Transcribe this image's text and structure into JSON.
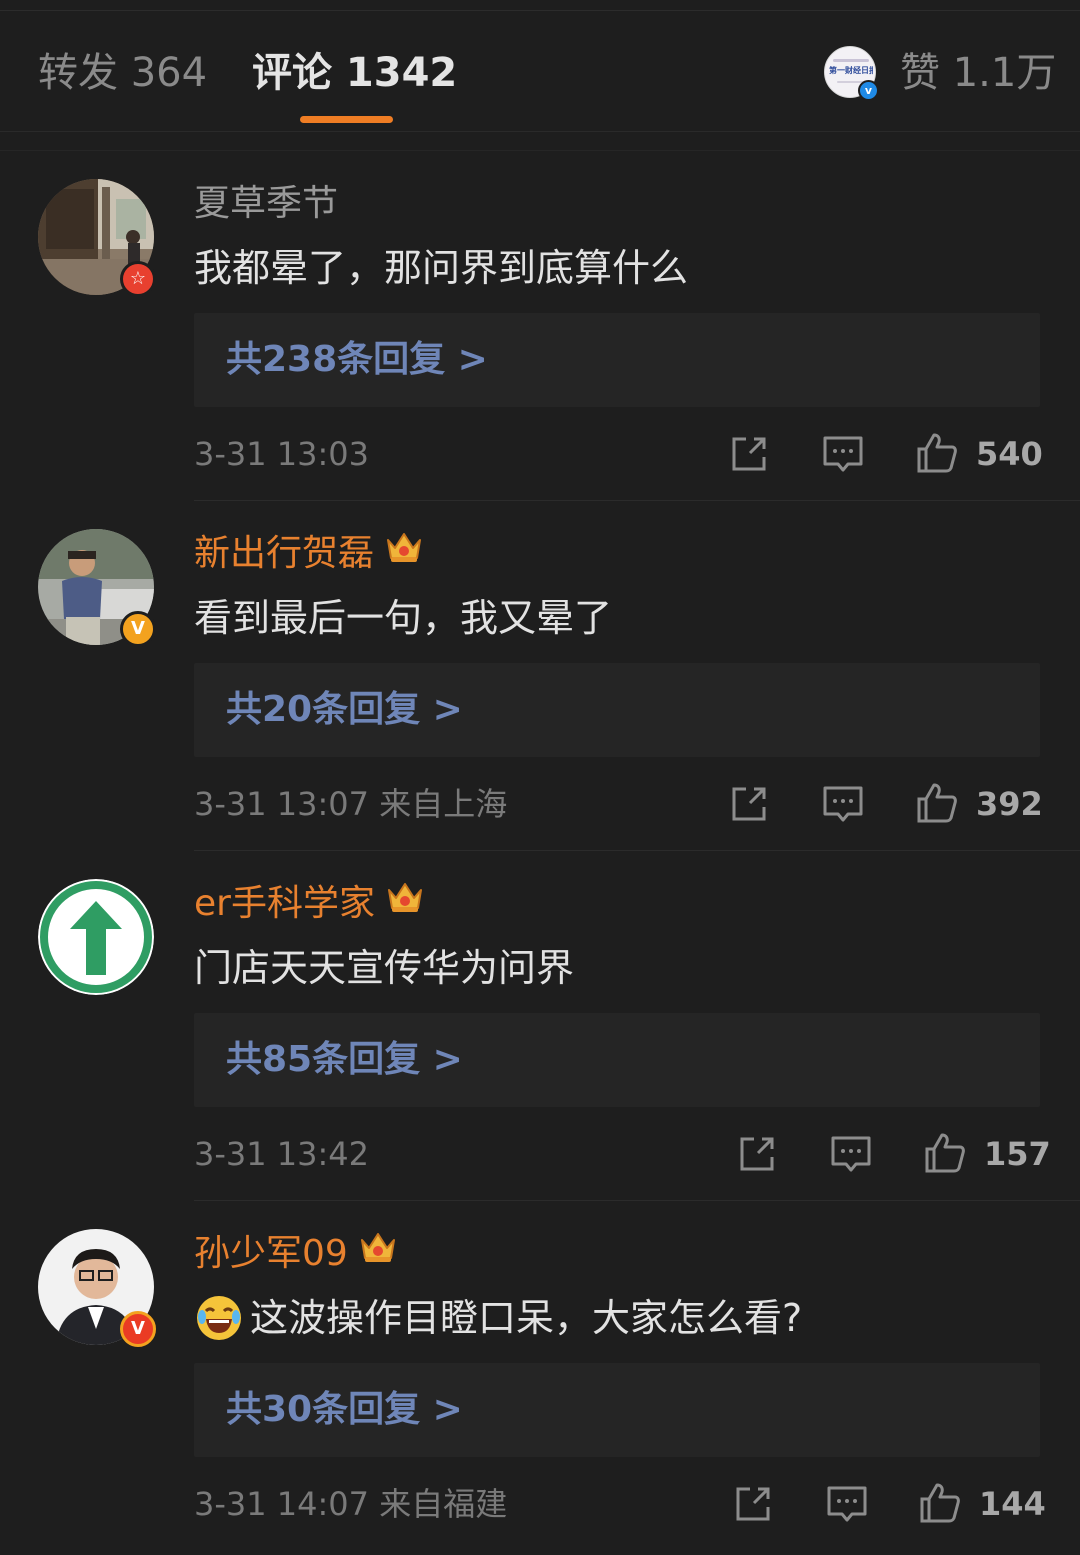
{
  "tabs": {
    "repost": "转发 364",
    "comment": "评论 1342",
    "likes": "赞 1.1万",
    "likes_avatar_text": "第一财经日报"
  },
  "comments": [
    {
      "user": "夏草季节",
      "user_style": "plain",
      "badge": "red-star",
      "text": "我都晕了，那问界到底算什么",
      "replies": "共238条回复 >",
      "meta": "3-31 13:03",
      "likes": "540"
    },
    {
      "user": "新出行贺磊",
      "user_style": "vip",
      "badge": "gold-v",
      "text": "看到最后一句，我又晕了",
      "replies": "共20条回复 >",
      "meta": "3-31 13:07  来自上海",
      "likes": "392"
    },
    {
      "user": "er手科学家",
      "user_style": "vip",
      "badge": "none",
      "text": "门店天天宣传华为问界",
      "replies": "共85条回复 >",
      "meta": "3-31 13:42",
      "likes": "157"
    },
    {
      "user": "孙少军09",
      "user_style": "vip",
      "badge": "red-v",
      "text": "这波操作目瞪口呆，大家怎么看?",
      "replies": "共30条回复 >",
      "meta": "3-31 14:07  来自福建",
      "likes": "144"
    }
  ],
  "icons": {
    "share": "share-icon",
    "reply": "comment-icon",
    "like": "thumbs-up-icon",
    "crown": "crown-icon",
    "laugh": "laugh-cry-emoji"
  },
  "colors": {
    "background": "#1e1e1e",
    "accent": "#ef7d24",
    "vip_name": "#e8812f",
    "reply_link": "#6f86b8"
  }
}
